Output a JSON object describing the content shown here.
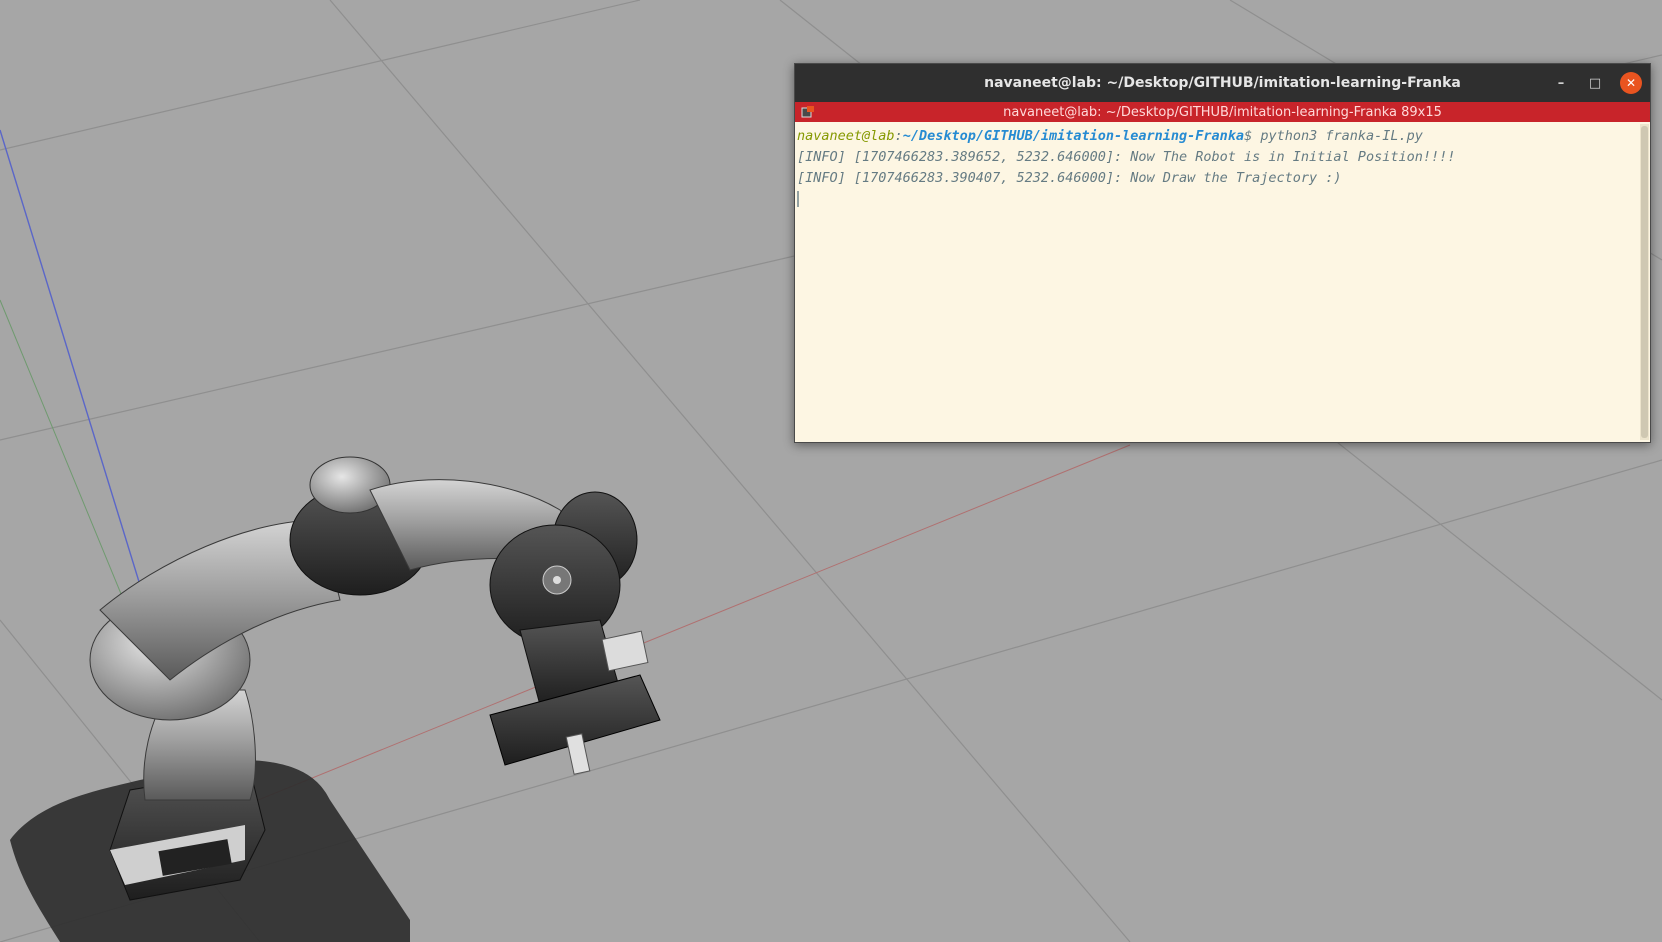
{
  "terminal": {
    "title": "navaneet@lab: ~/Desktop/GITHUB/imitation-learning-Franka",
    "tab_label": "navaneet@lab: ~/Desktop/GITHUB/imitation-learning-Franka 89x15",
    "prompt_user": "navaneet@lab",
    "prompt_sep": ":",
    "prompt_path": "~/Desktop/GITHUB/imitation-learning-Franka",
    "prompt_symbol": "$ ",
    "command": "python3 franka-IL.py",
    "output_lines": [
      "[INFO] [1707466283.389652, 5232.646000]: Now The Robot is in Initial Position!!!!",
      "[INFO] [1707466283.390407, 5232.646000]: Now Draw the Trajectory :)"
    ],
    "buttons": {
      "minimize": "–",
      "maximize": "□",
      "close": "✕"
    }
  },
  "colors": {
    "ground": "#a6a6a6",
    "titlebar": "#2f2f2f",
    "tab_accent": "#c8242a",
    "terminal_bg": "#fdf6e3",
    "close_button": "#e95420",
    "prompt_user": "#859900",
    "prompt_path": "#268bd2"
  },
  "icons": {
    "tab_icon": "terminal-tab-icon",
    "robot": "franka-robot-arm"
  }
}
